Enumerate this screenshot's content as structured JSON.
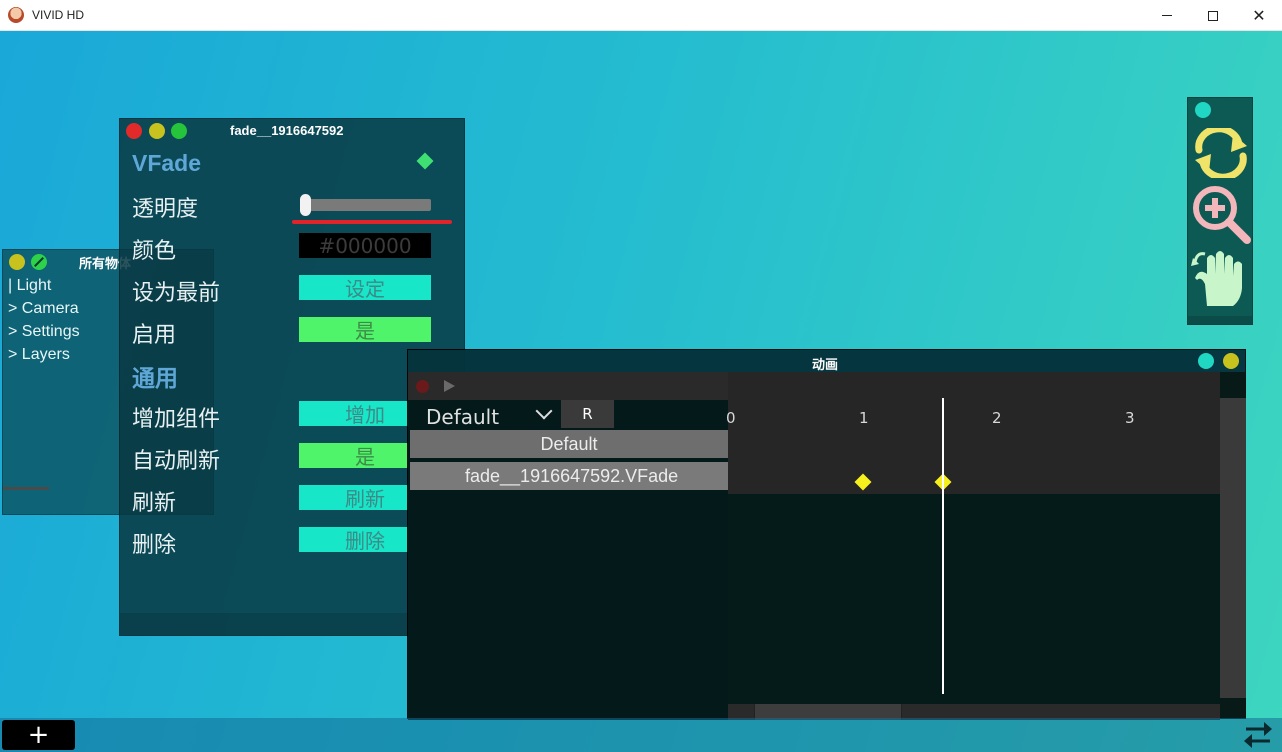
{
  "window": {
    "title": "VIVID HD",
    "minimize": "–",
    "maximize": "□",
    "close": "✕"
  },
  "object_list": {
    "title": "所有物体",
    "items": [
      "| Light",
      "> Camera",
      "> Settings",
      "> Layers"
    ]
  },
  "vfade": {
    "window_title": "fade__1916647592",
    "component_name": "VFade",
    "opacity_label": "透明度",
    "opacity_value": 0,
    "color_label": "颜色",
    "color_value": "#000000",
    "bring_front_label": "设为最前",
    "bring_front_button": "设定",
    "enable_label": "启用",
    "enable_value": "是",
    "section_general": "通用",
    "add_component_label": "增加组件",
    "add_component_button": "增加",
    "auto_refresh_label": "自动刷新",
    "auto_refresh_value": "是",
    "refresh_label": "刷新",
    "refresh_button": "刷新",
    "delete_label": "删除",
    "delete_button": "删除"
  },
  "animation": {
    "title": "动画",
    "clip_name": "Default",
    "reset_button": "R",
    "clip_header": "Default",
    "track_name": "fade__1916647592.VFade",
    "ruler_ticks": [
      "0",
      "1",
      "2",
      "3"
    ],
    "keyframes_at": [
      1.0,
      1.6
    ],
    "playhead_at": 1.6
  },
  "bottom": {
    "add_button": "+"
  },
  "colors": {
    "accent_cyan": "#17e6c9",
    "accent_green": "#4ff46a",
    "close_red": "#e0242a",
    "keyframe_yellow": "#f5f01e",
    "tool_yellow": "#f0e36a",
    "tool_pink": "#f3b6bb",
    "tool_mint": "#c8f5c9"
  },
  "icons": {
    "refresh": "refresh-icon",
    "zoom": "zoom-in-icon",
    "pan": "hand-icon",
    "swap": "swap-arrows-icon"
  }
}
